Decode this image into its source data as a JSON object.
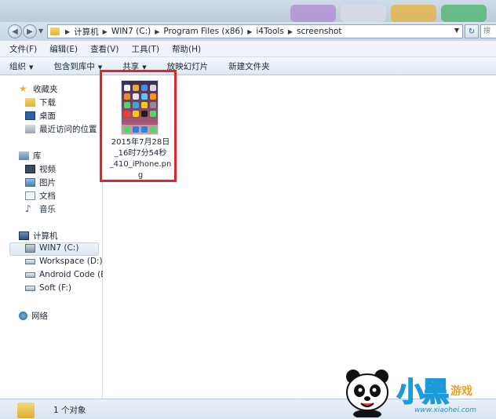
{
  "address": {
    "crumbs": [
      "计算机",
      "WIN7 (C:)",
      "Program Files (x86)",
      "i4Tools",
      "screenshot"
    ],
    "search_text": "搜"
  },
  "menubar": [
    {
      "label": "文件(F)"
    },
    {
      "label": "编辑(E)"
    },
    {
      "label": "查看(V)"
    },
    {
      "label": "工具(T)"
    },
    {
      "label": "帮助(H)"
    }
  ],
  "toolbar": [
    {
      "label": "组织",
      "dropdown": true
    },
    {
      "label": "包含到库中",
      "dropdown": true
    },
    {
      "label": "共享",
      "dropdown": true
    },
    {
      "label": "放映幻灯片",
      "dropdown": false
    },
    {
      "label": "新建文件夹",
      "dropdown": false
    }
  ],
  "navpane": {
    "favorites": {
      "label": "收藏夹",
      "icon": "star-icon",
      "items": [
        {
          "label": "下载",
          "icon": "download-folder-icon"
        },
        {
          "label": "桌面",
          "icon": "desktop-icon"
        },
        {
          "label": "最近访问的位置",
          "icon": "recent-places-icon"
        }
      ]
    },
    "libraries": {
      "label": "库",
      "icon": "library-icon",
      "items": [
        {
          "label": "视频",
          "icon": "video-library-icon"
        },
        {
          "label": "图片",
          "icon": "pictures-library-icon"
        },
        {
          "label": "文档",
          "icon": "documents-library-icon"
        },
        {
          "label": "音乐",
          "icon": "music-library-icon"
        }
      ]
    },
    "computer": {
      "label": "计算机",
      "icon": "computer-icon",
      "items": [
        {
          "label": "WIN7 (C:)",
          "icon": "system-drive-icon",
          "selected": true
        },
        {
          "label": "Workspace (D:)",
          "icon": "drive-icon"
        },
        {
          "label": "Android Code (E:)",
          "icon": "drive-icon"
        },
        {
          "label": "Soft (F:)",
          "icon": "drive-icon"
        }
      ]
    },
    "network": {
      "label": "网络",
      "icon": "network-icon"
    }
  },
  "files": [
    {
      "name": "2015年7月28日_16时7分54秒_410_iPhone.png",
      "name_lines": [
        "2015年7月28日",
        "_16时7分54秒",
        "_410_iPhone.pn",
        "g"
      ],
      "icon": "png-thumbnail-icon",
      "highlighted": true
    }
  ],
  "status": {
    "count_text": "1 个对象"
  },
  "watermark": {
    "title": "小黑",
    "subtitle": "游戏",
    "url": "www.xiaohei.com"
  },
  "colors": {
    "highlight": "#e0262a",
    "accent": "#1c9bd8"
  }
}
